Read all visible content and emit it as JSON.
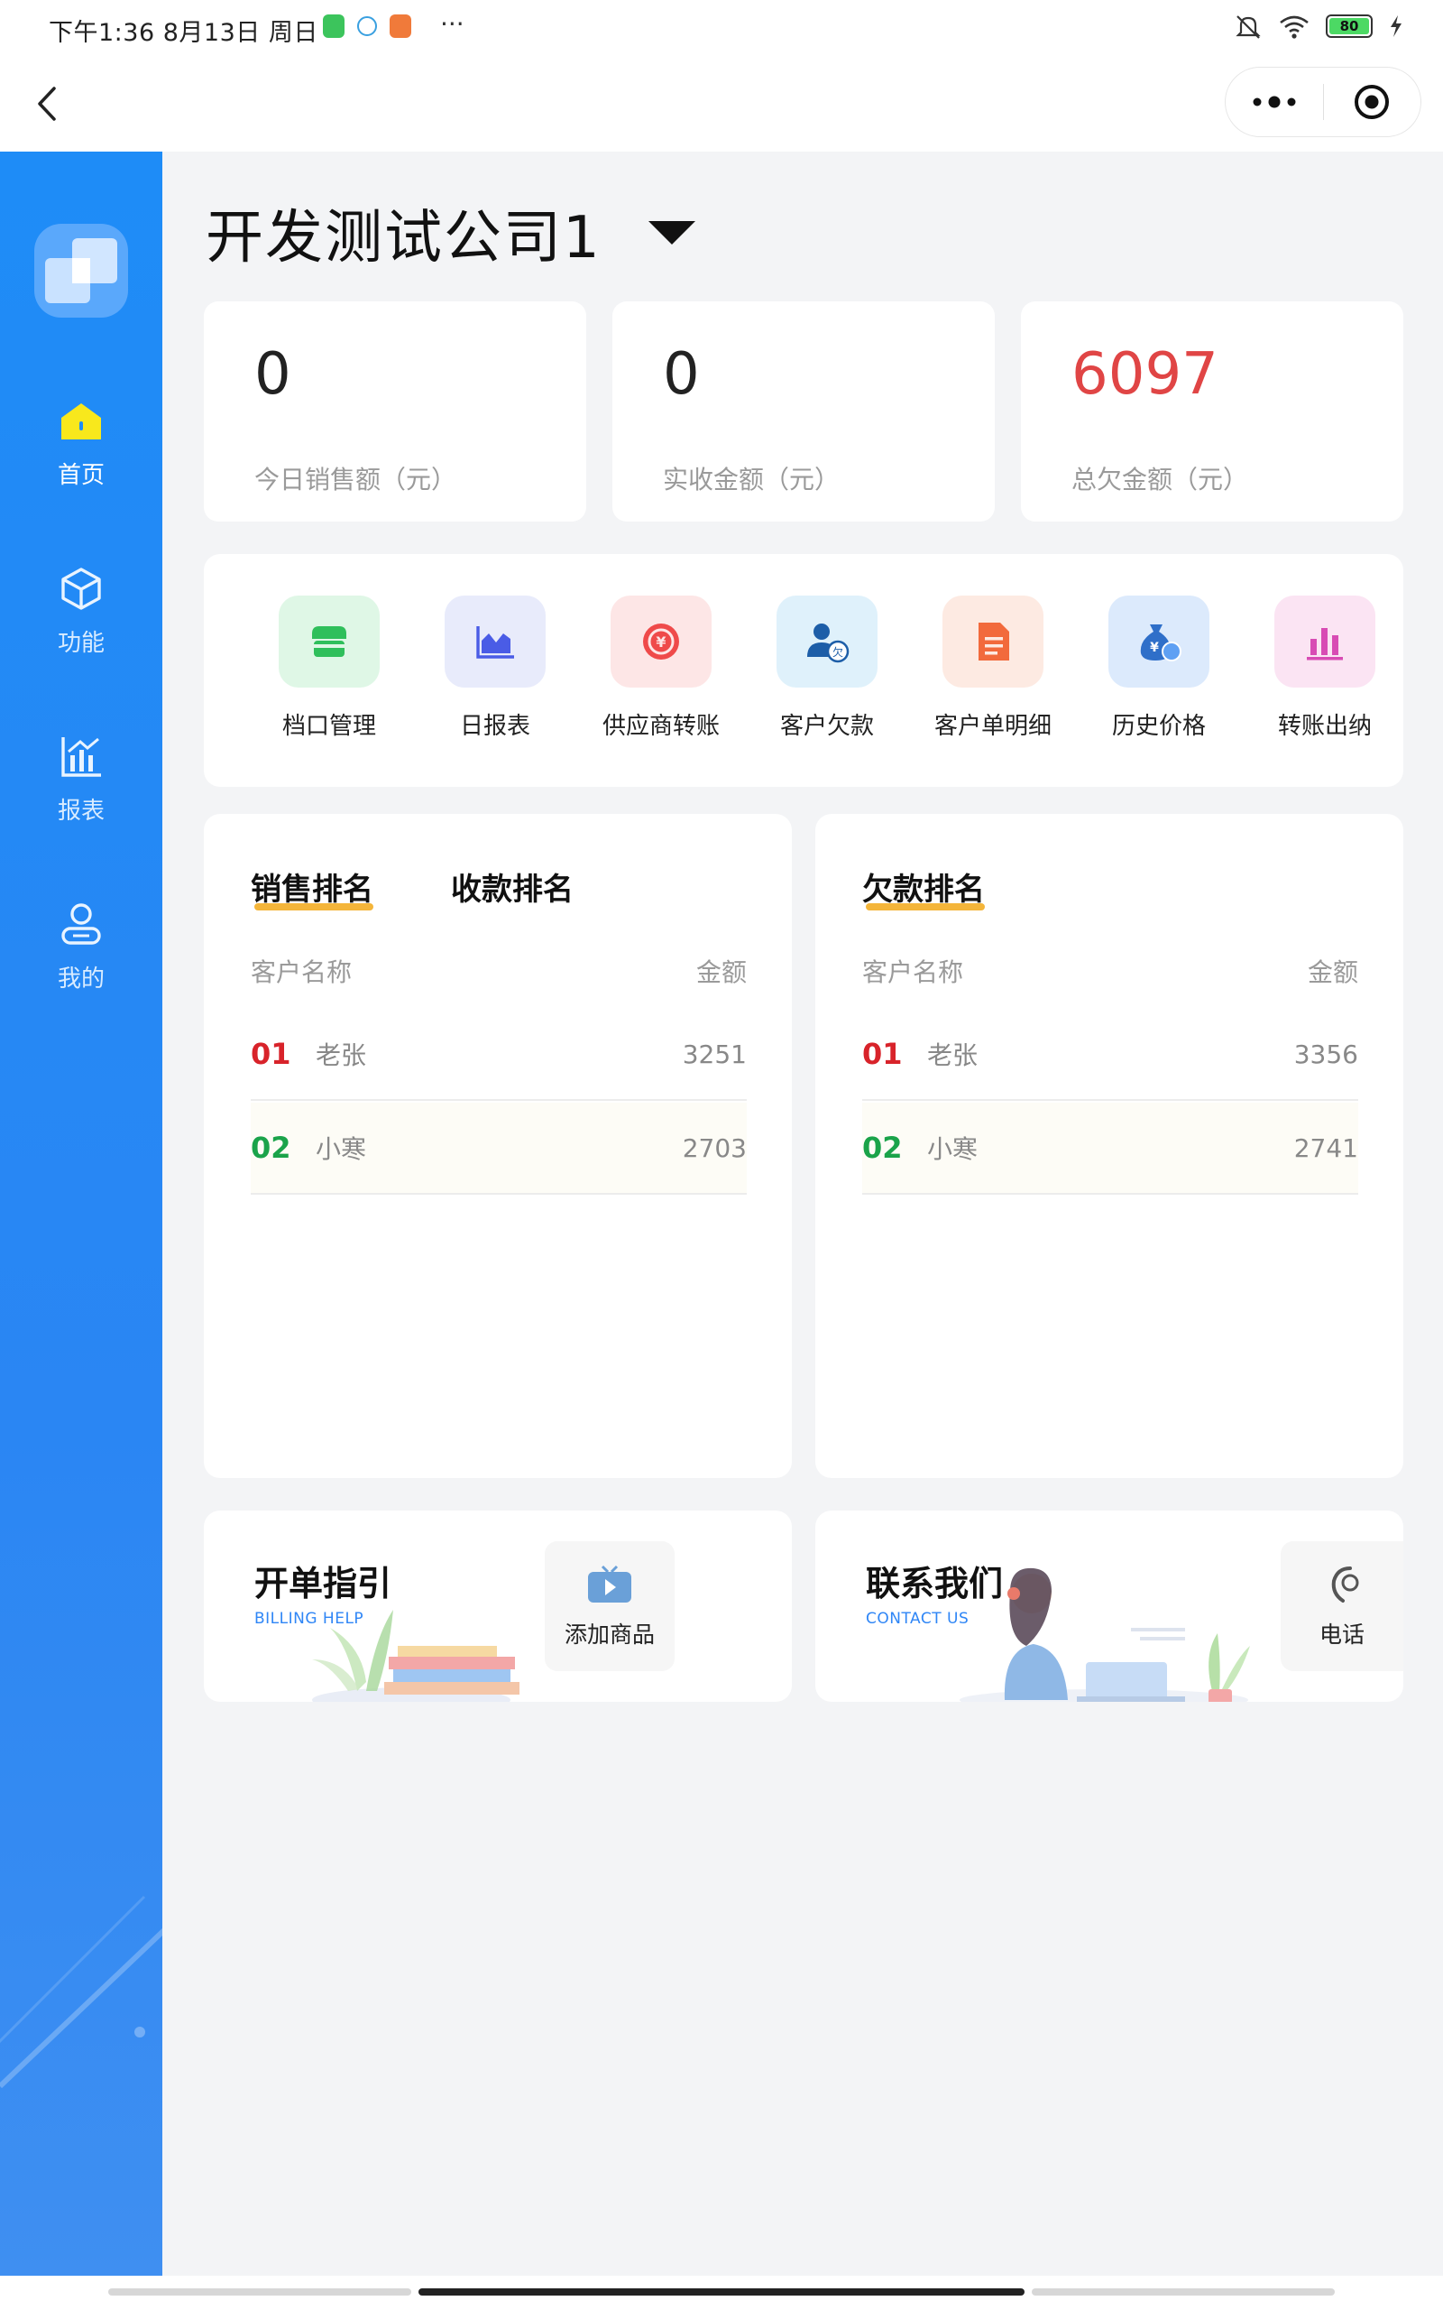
{
  "status_bar": {
    "time": "下午1:36  8月13日  周日",
    "more": "···",
    "battery": "80"
  },
  "nav": {
    "back_icon": "chevron-left-icon",
    "capsule_more_icon": "more-dots-icon",
    "capsule_close_icon": "target-circle-icon"
  },
  "sidebar": {
    "items": [
      {
        "label": "首页",
        "icon": "home-icon",
        "active": true
      },
      {
        "label": "功能",
        "icon": "cube-icon",
        "active": false
      },
      {
        "label": "报表",
        "icon": "bar-chart-icon",
        "active": false
      },
      {
        "label": "我的",
        "icon": "user-icon",
        "active": false
      }
    ]
  },
  "header": {
    "company": "开发测试公司1"
  },
  "stats": [
    {
      "value": "0",
      "label": "今日销售额（元）"
    },
    {
      "value": "0",
      "label": "实收金额（元）"
    },
    {
      "value": "6097",
      "label": "总欠金额（元）",
      "color": "#e04545"
    }
  ],
  "functions": [
    {
      "label": "档口管理",
      "icon": "shop-icon",
      "bg": "#dff7e6",
      "fg": "#2fbf5b"
    },
    {
      "label": "日报表",
      "icon": "area-chart-icon",
      "bg": "#e8ebfb",
      "fg": "#4a5ce6"
    },
    {
      "label": "供应商转账",
      "icon": "yen-transfer-icon",
      "bg": "#fde6e6",
      "fg": "#ef4a4a"
    },
    {
      "label": "客户欠款",
      "icon": "customer-debt-icon",
      "bg": "#dff1fb",
      "fg": "#2a7fd8"
    },
    {
      "label": "客户单明细",
      "icon": "document-icon",
      "bg": "#fdeae2",
      "fg": "#f26a3c"
    },
    {
      "label": "历史价格",
      "icon": "money-bag-icon",
      "bg": "#dceafc",
      "fg": "#3a86f0"
    },
    {
      "label": "转账出纳",
      "icon": "bar-chart-icon",
      "bg": "#fbe4f3",
      "fg": "#d84bb4"
    }
  ],
  "sales_rank": {
    "tabs": [
      "销售排名",
      "收款排名"
    ],
    "col_name": "客户名称",
    "col_amount": "金额",
    "rows": [
      {
        "no": "01",
        "name": "老张",
        "amount": "3251"
      },
      {
        "no": "02",
        "name": "小寒",
        "amount": "2703"
      }
    ]
  },
  "debt_rank": {
    "tabs": [
      "欠款排名"
    ],
    "col_name": "客户名称",
    "col_amount": "金额",
    "rows": [
      {
        "no": "01",
        "name": "老张",
        "amount": "3356"
      },
      {
        "no": "02",
        "name": "小寒",
        "amount": "2741"
      }
    ]
  },
  "billing_help": {
    "title": "开单指引",
    "subtitle": "BILLING HELP",
    "button_label": "添加商品",
    "button_icon": "video-play-icon"
  },
  "contact": {
    "title": "联系我们",
    "subtitle": "CONTACT US",
    "button_label": "电话",
    "button_icon": "phone-icon"
  },
  "colors": {
    "sidebar": "#1e8cf7",
    "accent_underline": "#f4b53a",
    "rank_first": "#d8232a",
    "rank_second": "#1aa34a"
  }
}
